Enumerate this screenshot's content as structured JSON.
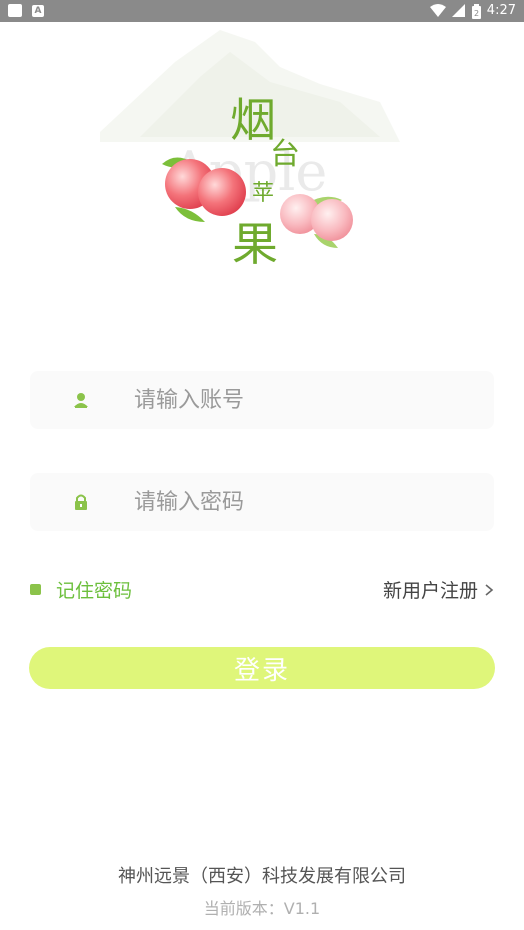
{
  "status_bar": {
    "time": "4:27"
  },
  "logo": {
    "title_chars": [
      "烟",
      "台",
      "苹",
      "果"
    ],
    "watermark": "Apple"
  },
  "form": {
    "account_placeholder": "请输入账号",
    "password_placeholder": "请输入密码",
    "remember_label": "记住密码",
    "register_label": "新用户注册",
    "login_label": "登录"
  },
  "footer": {
    "company": "神州远景（西安）科技发展有限公司",
    "version": "当前版本：V1.1"
  },
  "colors": {
    "accent_green": "#6cbf3c",
    "checkbox_green": "#8bc34a",
    "login_button": "#dff67a",
    "status_bar": "#8a8a8a"
  }
}
